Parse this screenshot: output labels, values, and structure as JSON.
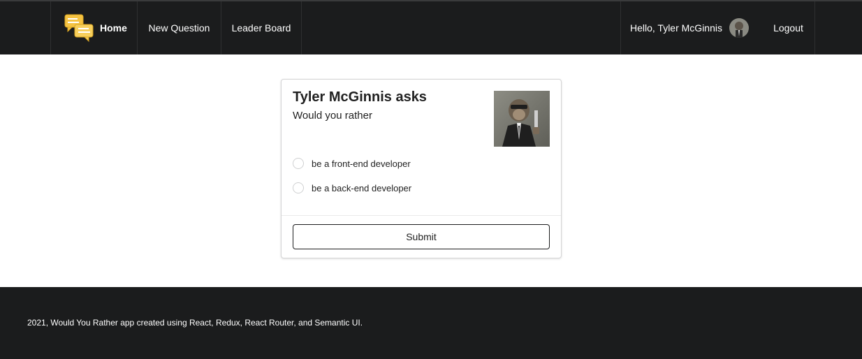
{
  "navbar": {
    "home_label": "Home",
    "new_question_label": "New Question",
    "leader_board_label": "Leader Board",
    "greeting": "Hello, Tyler McGinnis",
    "logout_label": "Logout",
    "logo_icon": "chat-bubbles-icon",
    "avatar_icon": "user-avatar"
  },
  "question": {
    "title": "Tyler McGinnis asks",
    "prompt": "Would you rather",
    "options": [
      {
        "label": "be a front-end developer",
        "selected": false
      },
      {
        "label": "be a back-end developer",
        "selected": false
      }
    ],
    "submit_label": "Submit"
  },
  "footer": {
    "text": "2021, Would You Rather app created using React, Redux, React Router, and Semantic UI."
  },
  "colors": {
    "nav_bg": "#1b1c1d",
    "footer_bg": "#1b1c1d",
    "logo_yellow": "#f5c342"
  }
}
